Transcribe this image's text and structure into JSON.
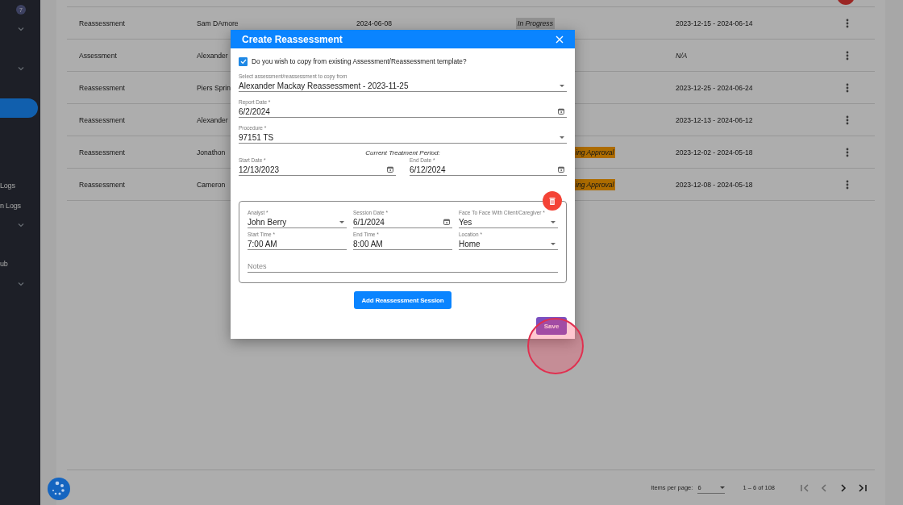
{
  "sidebar": {
    "badge": "7",
    "items": [
      {
        "kind": "group",
        "expanded": false,
        "selected": false
      },
      {
        "kind": "group",
        "expanded": false,
        "selected": false
      },
      {
        "kind": "link",
        "selected": true
      },
      {
        "kind": "link",
        "label": "Logs",
        "selected": false
      },
      {
        "kind": "link",
        "label": "n Logs",
        "selected": false
      },
      {
        "kind": "group",
        "expanded": false,
        "selected": false
      },
      {
        "kind": "link",
        "label": "ub",
        "selected": false
      },
      {
        "kind": "group",
        "expanded": false,
        "selected": false
      }
    ]
  },
  "table": {
    "rows": [
      {
        "type": "Reassessment",
        "name": "Sam DAmore",
        "date": "2024-06-08",
        "status": {
          "text": "In Progress",
          "kind": "in_progress"
        },
        "period": "2023-12-15 - 2024-06-14",
        "period_italic": false
      },
      {
        "type": "Assessment",
        "name": "Alexander",
        "period": "N/A",
        "period_italic": true
      },
      {
        "type": "Reassessment",
        "name": "Piers Sprin",
        "period": "2023-12-25 - 2024-06-24",
        "period_italic": false
      },
      {
        "type": "Reassessment",
        "name": "Alexander",
        "period": "2023-12-13 - 2024-06-12",
        "period_italic": false
      },
      {
        "type": "Reassessment",
        "name": "Jonathon",
        "status": {
          "text": "ing Approval",
          "kind": "pending"
        },
        "period": "2023-12-02 - 2024-05-18",
        "period_italic": false
      },
      {
        "type": "Reassessment",
        "name": "Cameron",
        "status": {
          "text": "ing Approval",
          "kind": "pending"
        },
        "period": "2023-12-08 - 2024-05-18",
        "period_italic": false
      }
    ]
  },
  "paginator": {
    "items_label": "Items per page:",
    "page_size": "6",
    "range": "1 – 6 of 108",
    "nav": [
      {
        "kind": "first",
        "disabled": true
      },
      {
        "kind": "prev",
        "disabled": true
      },
      {
        "kind": "next",
        "disabled": false
      },
      {
        "kind": "last",
        "disabled": false
      }
    ]
  },
  "dialog": {
    "title": "Create Reassessment",
    "copy_checkbox": {
      "label": "Do you wish to copy from existing Assessment/Reassessment template?",
      "checked": true
    },
    "fields": [
      {
        "label": "Select assessment/reassessment to copy from",
        "value": "Alexander Mackay Reassessment - 2023-11-25",
        "kind": "select"
      },
      {
        "label": "Report Date *",
        "value": "6/2/2024",
        "kind": "date"
      },
      {
        "label": "Procedure *",
        "value": "97151 TS",
        "kind": "select"
      }
    ],
    "period_heading": "Current Treatment Period:",
    "period_fields": [
      {
        "label": "Start Date *",
        "value": "12/13/2023",
        "kind": "date"
      },
      {
        "label": "End Date *",
        "value": "6/12/2024",
        "kind": "date"
      }
    ],
    "session": {
      "fields": [
        {
          "label": "Analyst *",
          "value": "John Berry",
          "kind": "select"
        },
        {
          "label": "Session Date *",
          "value": "6/1/2024",
          "kind": "date"
        },
        {
          "label": "Face To Face With Client/Caregiver *",
          "value": "Yes",
          "kind": "select"
        },
        {
          "label": "Start Time *",
          "value": "7:00 AM",
          "kind": "text"
        },
        {
          "label": "End Time *",
          "value": "8:00 AM",
          "kind": "text"
        },
        {
          "label": "Location *",
          "value": "Home",
          "kind": "select"
        }
      ],
      "notes": {
        "placeholder": "Notes"
      }
    },
    "add_button": "Add Reassessment Session",
    "save_button": "Save"
  }
}
